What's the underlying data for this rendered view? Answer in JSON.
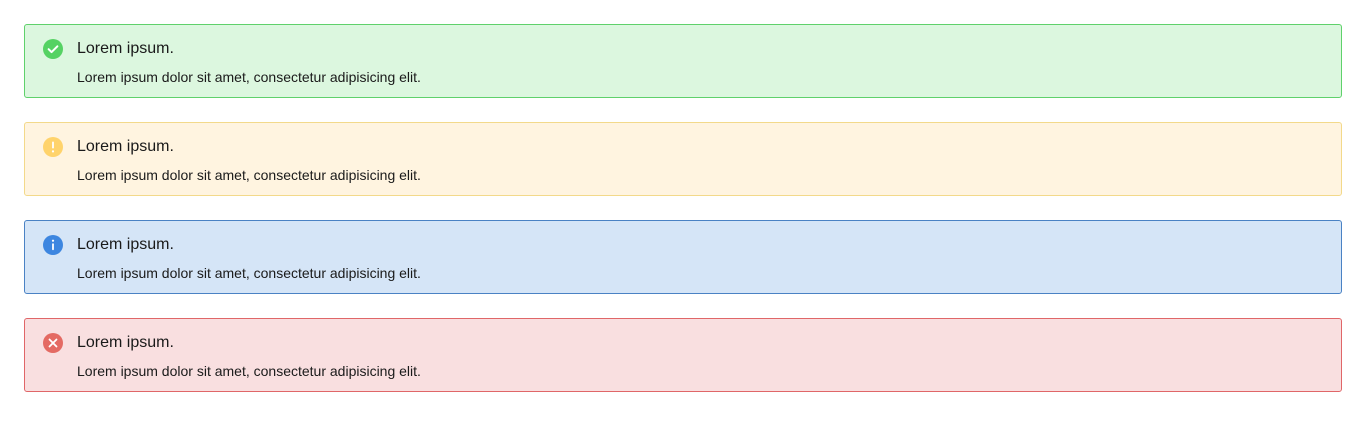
{
  "alerts": [
    {
      "type": "success",
      "icon": "check-circle-icon",
      "icon_color": "#55d263",
      "title": "Lorem ipsum.",
      "description": "Lorem ipsum dolor sit amet, consectetur adipisicing elit.",
      "background": "#dcf7df",
      "border": "#5fd16b"
    },
    {
      "type": "warning",
      "icon": "exclamation-circle-icon",
      "icon_color": "#ffd36b",
      "title": "Lorem ipsum.",
      "description": "Lorem ipsum dolor sit amet, consectetur adipisicing elit.",
      "background": "#fff4e0",
      "border": "#f3d98a"
    },
    {
      "type": "info",
      "icon": "info-circle-icon",
      "icon_color": "#3d86e0",
      "title": "Lorem ipsum.",
      "description": "Lorem ipsum dolor sit amet, consectetur adipisicing elit.",
      "background": "#d5e5f7",
      "border": "#4a82c4"
    },
    {
      "type": "error",
      "icon": "close-circle-icon",
      "icon_color": "#e46a63",
      "title": "Lorem ipsum.",
      "description": "Lorem ipsum dolor sit amet, consectetur adipisicing elit.",
      "background": "#f9dfe0",
      "border": "#e06668"
    }
  ]
}
